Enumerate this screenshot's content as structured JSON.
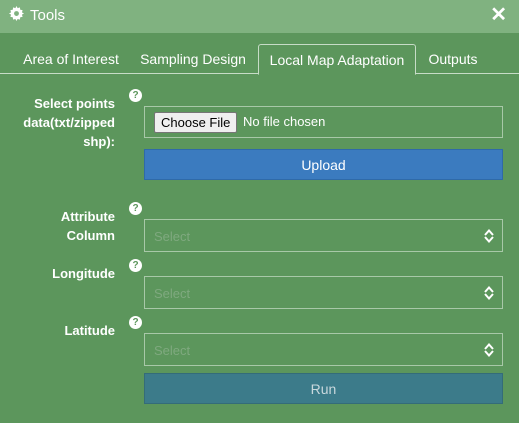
{
  "window": {
    "title": "Tools",
    "close_glyph": "✕",
    "gear_icon": "gear-icon"
  },
  "tabs": [
    {
      "label": "Area of Interest",
      "active": false
    },
    {
      "label": "Sampling Design",
      "active": false
    },
    {
      "label": "Local Map Adaptation",
      "active": true
    },
    {
      "label": "Outputs",
      "active": false
    }
  ],
  "form": {
    "points": {
      "label": "Select points data(txt/zipped shp):",
      "file_button": "Choose File",
      "file_status": "No file chosen",
      "upload_label": "Upload"
    },
    "attribute": {
      "label": "Attribute Column",
      "placeholder": "Select"
    },
    "longitude": {
      "label": "Longitude",
      "placeholder": "Select"
    },
    "latitude": {
      "label": "Latitude",
      "placeholder": "Select"
    },
    "run_label": "Run",
    "help_glyph": "?"
  },
  "colors": {
    "panel": "#5c965c",
    "titlebar": "#80b280",
    "upload": "#3b7bbf",
    "run": "#3c7b8a"
  }
}
